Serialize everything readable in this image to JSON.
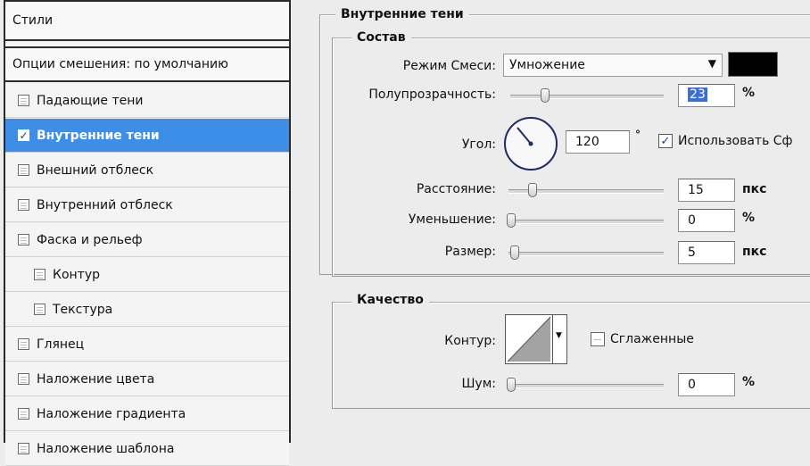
{
  "styles_panel": {
    "header": "Стили",
    "blend_options": "Опции смешения: по умолчанию",
    "items": [
      {
        "label": "Падающие тени",
        "checked": false,
        "indent": false
      },
      {
        "label": "Внутренние тени",
        "checked": true,
        "indent": false,
        "active": true
      },
      {
        "label": "Внешний отблеск",
        "checked": false,
        "indent": false
      },
      {
        "label": "Внутренний отблеск",
        "checked": false,
        "indent": false
      },
      {
        "label": "Фаска и рельеф",
        "checked": false,
        "indent": false
      },
      {
        "label": "Контур",
        "checked": false,
        "indent": true
      },
      {
        "label": "Текстура",
        "checked": false,
        "indent": true
      },
      {
        "label": "Глянец",
        "checked": false,
        "indent": false
      },
      {
        "label": "Наложение цвета",
        "checked": false,
        "indent": false
      },
      {
        "label": "Наложение градиента",
        "checked": false,
        "indent": false
      },
      {
        "label": "Наложение шаблона",
        "checked": false,
        "indent": false
      }
    ]
  },
  "inner_shadow": {
    "title": "Внутренние тени",
    "structure": {
      "legend": "Состав",
      "blend_mode_label": "Режим Смеси:",
      "blend_mode_value": "Умножение",
      "color_swatch": "#000000",
      "opacity_label": "Полупрозрачность:",
      "opacity_value": "23",
      "opacity_unit": "%",
      "angle_label": "Угол:",
      "angle_value": "120",
      "angle_unit": "°",
      "global_light_label": "Использовать Сф",
      "global_light_checked": true,
      "distance_label": "Расстояние:",
      "distance_value": "15",
      "distance_unit": "пкс",
      "choke_label": "Уменьшение:",
      "choke_value": "0",
      "choke_unit": "%",
      "size_label": "Размер:",
      "size_value": "5",
      "size_unit": "пкс"
    },
    "quality": {
      "legend": "Качество",
      "contour_label": "Контур:",
      "antialiased_label": "Сглаженные",
      "antialiased_checked": false,
      "noise_label": "Шум:",
      "noise_value": "0",
      "noise_unit": "%"
    }
  }
}
